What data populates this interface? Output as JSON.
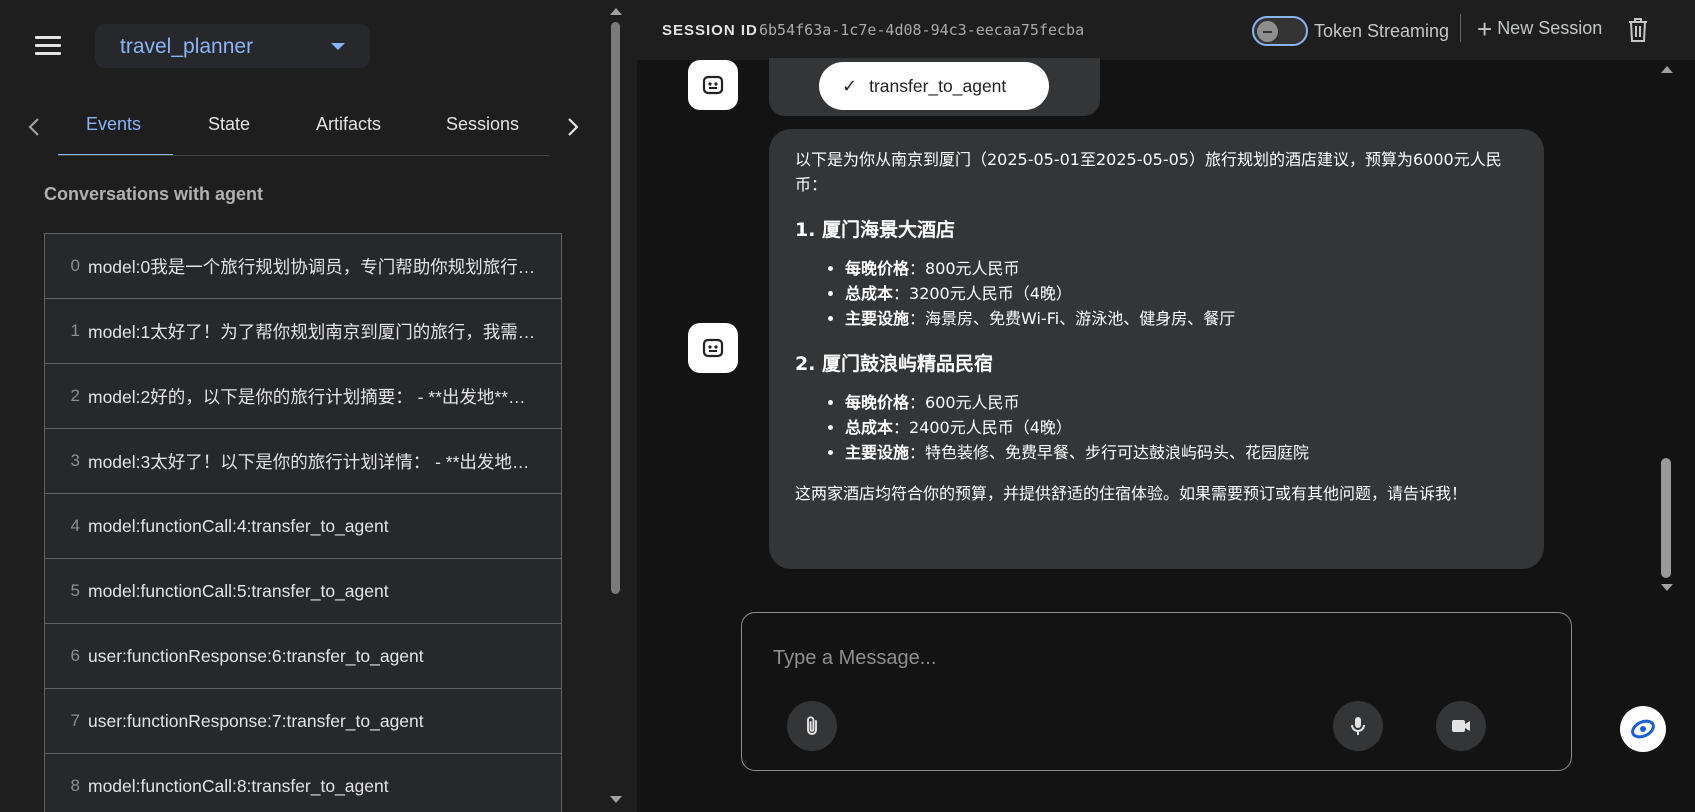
{
  "app_selector": {
    "value": "travel_planner"
  },
  "tabs": [
    {
      "label": "Events"
    },
    {
      "label": "State"
    },
    {
      "label": "Artifacts"
    },
    {
      "label": "Sessions"
    }
  ],
  "events_section": {
    "title": "Conversations with agent",
    "rows": [
      {
        "index": "0",
        "text": "model:0我是一个旅行规划协调员，专门帮助你规划旅行…"
      },
      {
        "index": "1",
        "text": "model:1太好了！为了帮你规划南京到厦门的旅行，我需…"
      },
      {
        "index": "2",
        "text": "model:2好的，以下是你的旅行计划摘要： - **出发地**…"
      },
      {
        "index": "3",
        "text": "model:3太好了！以下是你的旅行计划详情： - **出发地…"
      },
      {
        "index": "4",
        "text": "model:functionCall:4:transfer_to_agent"
      },
      {
        "index": "5",
        "text": "model:functionCall:5:transfer_to_agent"
      },
      {
        "index": "6",
        "text": "user:functionResponse:6:transfer_to_agent"
      },
      {
        "index": "7",
        "text": "user:functionResponse:7:transfer_to_agent"
      },
      {
        "index": "8",
        "text": "model:functionCall:8:transfer_to_agent"
      }
    ]
  },
  "header": {
    "session_label": "SESSION ID",
    "session_id": "6b54f63a-1c7e-4d08-94c3-eecaa75fecba",
    "token_streaming_label": "Token Streaming",
    "new_session_label": "New Session"
  },
  "chat": {
    "tool_chip_label": "transfer_to_agent",
    "message": {
      "intro": "以下是为你从南京到厦门（2025-05-01至2025-05-05）旅行规划的酒店建议，预算为6000元人民币：",
      "hotels": [
        {
          "title": "1. 厦门海景大酒店",
          "items": [
            {
              "key": "每晚价格",
              "value": "：800元人民币"
            },
            {
              "key": "总成本",
              "value": "：3200元人民币（4晚）"
            },
            {
              "key": "主要设施",
              "value": "：海景房、免费Wi-Fi、游泳池、健身房、餐厅"
            }
          ]
        },
        {
          "title": "2. 厦门鼓浪屿精品民宿",
          "items": [
            {
              "key": "每晚价格",
              "value": "：600元人民币"
            },
            {
              "key": "总成本",
              "value": "：2400元人民币（4晚）"
            },
            {
              "key": "主要设施",
              "value": "：特色装修、免费早餐、步行可达鼓浪屿码头、花园庭院"
            }
          ]
        }
      ],
      "outro": "这两家酒店均符合你的预算，并提供舒适的住宿体验。如果需要预订或有其他问题，请告诉我！"
    }
  },
  "input": {
    "placeholder": "Type a Message..."
  },
  "colors": {
    "accent": "#8ab4f8",
    "panel": "#1e1e1f",
    "bubble": "#333537"
  }
}
